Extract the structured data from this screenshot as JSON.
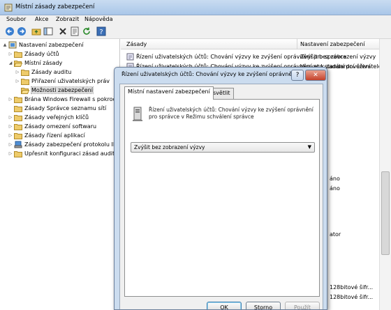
{
  "window": {
    "title": "Místní zásady zabezpečení",
    "menu": [
      "Soubor",
      "Akce",
      "Zobrazit",
      "Nápověda"
    ]
  },
  "toolbar": {
    "icons": [
      "back-arrow-icon",
      "forward-arrow-icon",
      "up-folder-icon",
      "show-hide-tree-icon",
      "delete-icon",
      "properties-icon",
      "refresh-icon",
      "help-icon"
    ]
  },
  "tree": {
    "items": [
      {
        "label": "Nastavení zabezpečení",
        "icon": "security-settings-icon",
        "expander": "▲"
      },
      {
        "label": "Zásady účtů",
        "icon": "folder-icon",
        "expander": "▷"
      },
      {
        "label": "Místní zásady",
        "icon": "folder-open-icon",
        "expander": "◢"
      },
      {
        "label": "Zásady auditu",
        "icon": "folder-icon",
        "expander": "▷"
      },
      {
        "label": "Přiřazení uživatelských práv",
        "icon": "folder-icon",
        "expander": "▷"
      },
      {
        "label": "Možnosti zabezpečení",
        "icon": "folder-open-icon",
        "expander": ""
      },
      {
        "label": "Brána Windows Firewall s pokročilým zabezpečením",
        "icon": "folder-icon",
        "expander": "▷"
      },
      {
        "label": "Zásady Správce seznamu sítí",
        "icon": "folder-icon",
        "expander": ""
      },
      {
        "label": "Zásady veřejných klíčů",
        "icon": "folder-icon",
        "expander": "▷"
      },
      {
        "label": "Zásady omezení softwaru",
        "icon": "folder-icon",
        "expander": "▷"
      },
      {
        "label": "Zásady řízení aplikací",
        "icon": "folder-icon",
        "expander": "▷"
      },
      {
        "label": "Zásady zabezpečení protokolu IP v místním počítači",
        "icon": "ipsec-policy-icon",
        "expander": "▷"
      },
      {
        "label": "Upřesnit konfiguraci zásad auditování",
        "icon": "folder-icon",
        "expander": "▷"
      }
    ]
  },
  "list": {
    "col_policy": "Zásady",
    "col_setting": "Nastavení zabezpečení",
    "rows": [
      {
        "policy": "Řízení uživatelských účtů: Chování výzvy ke zvýšení oprávnění pro správce",
        "setting": "Zvýšit bez zobrazení výzvy"
      },
      {
        "policy": "Řízení uživatelských účtů: Chování výzvy ke zvýšení oprávnění pro standardní uživatele",
        "setting": "Vyzvat k zadání pověření"
      }
    ],
    "partial_values": [
      "áno",
      "áno",
      "ator",
      "128bitové šifr...",
      "128bitové šifr..."
    ]
  },
  "dialog": {
    "title": "Řízení uživatelských účtů: Chování výzvy ke zvýšení oprávnění pro správce – vlastnosti",
    "help_label": "?",
    "close_label": "✕",
    "tabs": [
      "Místní nastavení zabezpečení",
      "Vysvětlit"
    ],
    "description": "Řízení uživatelských účtů: Chování výzvy ke zvýšení oprávnění pro správce v Režimu schválení správce",
    "selected_option": "Zvýšit bez zobrazení výzvy",
    "buttons": {
      "ok": "OK",
      "cancel": "Storno",
      "apply": "Použít"
    }
  }
}
